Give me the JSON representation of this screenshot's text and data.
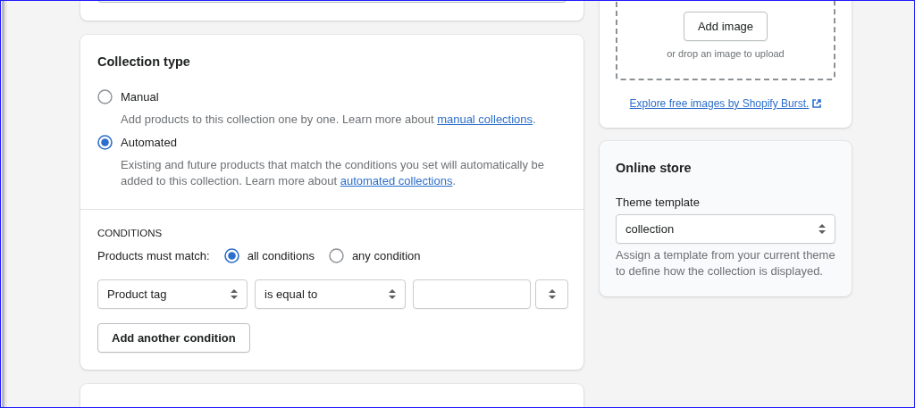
{
  "image_card": {
    "button": "Add image",
    "hint": "or drop an image to upload",
    "link": "Explore free images by Shopify Burst."
  },
  "collection_type": {
    "title": "Collection type",
    "options": [
      {
        "label": "Manual",
        "selected": false,
        "description": "Add products to this collection one by one. Learn more about ",
        "link": "manual collections",
        "after": "."
      },
      {
        "label": "Automated",
        "selected": true,
        "description": "Existing and future products that match the conditions you set will automatically be added to this collection. Learn more about ",
        "link": "automated collections",
        "after": "."
      }
    ]
  },
  "conditions": {
    "heading": "CONDITIONS",
    "match_label": "Products must match:",
    "match_options": [
      {
        "label": "all conditions",
        "selected": true
      },
      {
        "label": "any condition",
        "selected": false
      }
    ],
    "rules": [
      {
        "field": "Product tag",
        "relation": "is equal to"
      }
    ],
    "add_button": "Add another condition"
  },
  "online_store": {
    "title": "Online store",
    "template_label": "Theme template",
    "template_value": "collection",
    "help": "Assign a template from your current theme to define how the collection is displayed."
  }
}
